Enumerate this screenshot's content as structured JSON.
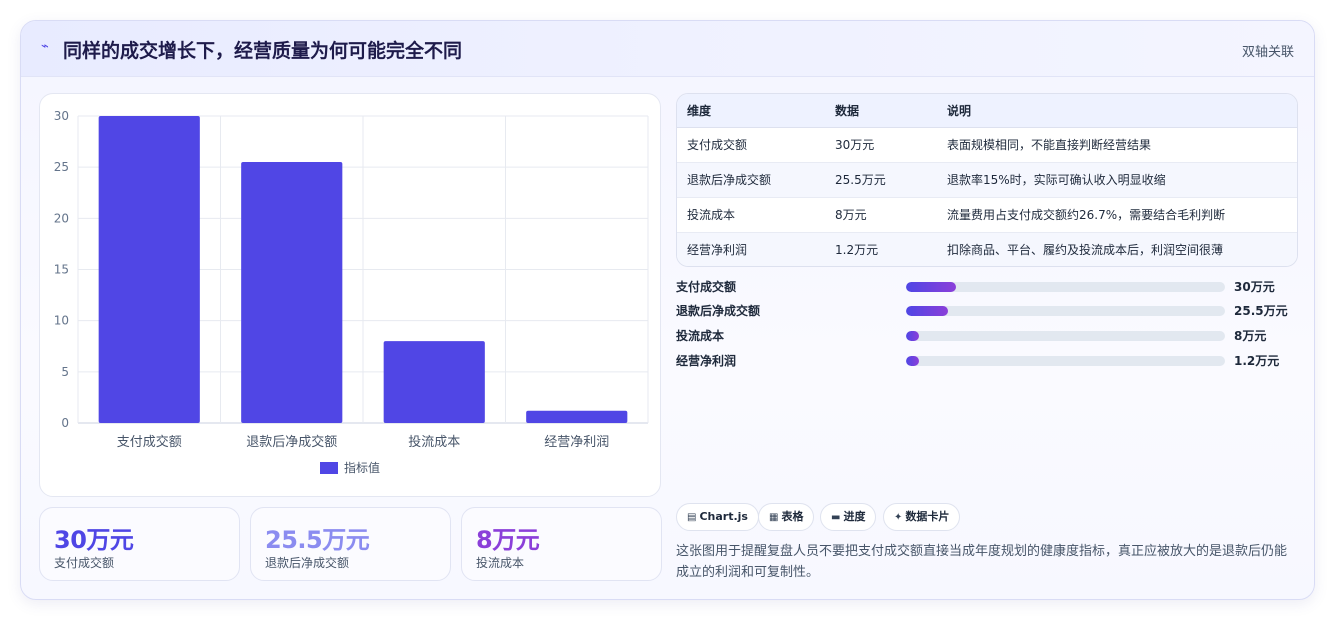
{
  "header": {
    "icon": "chart-icon",
    "title": "同样的成交增长下，经营质量为何可能完全不同",
    "right_label": "双轴关联"
  },
  "chart_data": {
    "type": "bar",
    "categories": [
      "支付成交额",
      "退款后净成交额",
      "投流成本",
      "经营净利润"
    ],
    "series": [
      {
        "name": "指标值",
        "values": [
          30,
          25.5,
          8,
          1.2
        ],
        "color": "#5046e5"
      }
    ],
    "ylim": [
      0,
      30
    ],
    "yticks": [
      0,
      5,
      10,
      15,
      20,
      25,
      30
    ],
    "grid": true,
    "legend": "bottom-center",
    "title": "",
    "xlabel": "",
    "ylabel": ""
  },
  "stats": [
    {
      "value": "30万元",
      "label": "支付成交额",
      "color": "#4f46e5"
    },
    {
      "value": "25.5万元",
      "label": "退款后净成交额",
      "color": "#8b8cf0"
    },
    {
      "value": "8万元",
      "label": "投流成本",
      "color": "#8b3fd9"
    }
  ],
  "table": {
    "headers": [
      "维度",
      "数据",
      "说明"
    ],
    "rows": [
      [
        "支付成交额",
        "30万元",
        "表面规模相同，不能直接判断经营结果"
      ],
      [
        "退款后净成交额",
        "25.5万元",
        "退款率15%时，实际可确认收入明显收缩"
      ],
      [
        "投流成本",
        "8万元",
        "流量费用占支付成交额约26.7%，需要结合毛利判断"
      ],
      [
        "经营净利润",
        "1.2万元",
        "扣除商品、平台、履约及投流成本后，利润空间很薄"
      ]
    ]
  },
  "progress": [
    {
      "label": "支付成交额",
      "value": "30万元",
      "fraction": 0.157
    },
    {
      "label": "退款后净成交额",
      "value": "25.5万元",
      "fraction": 0.132
    },
    {
      "label": "投流成本",
      "value": "8万元",
      "fraction": 0.042
    },
    {
      "label": "经营净利润",
      "value": "1.2万元",
      "fraction": 0.042
    }
  ],
  "chips": [
    {
      "icon": "chart-icon",
      "glyph": "▤",
      "label": "Chart.js"
    },
    {
      "icon": "table-icon",
      "glyph": "▦",
      "label": "表格"
    },
    {
      "icon": "progress-icon",
      "glyph": "▬",
      "label": "进度"
    },
    {
      "icon": "sparkle-icon",
      "glyph": "✦",
      "label": "数据卡片"
    }
  ],
  "description": "这张图用于提醒复盘人员不要把支付成交额直接当成年度规划的健康度指标，真正应被放大的是退款后仍能成立的利润和可复制性。"
}
